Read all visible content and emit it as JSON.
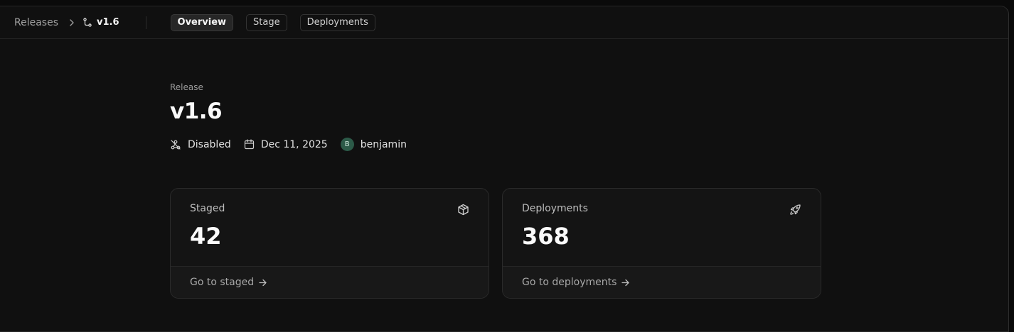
{
  "breadcrumb": {
    "parent": "Releases",
    "current": "v1.6"
  },
  "tabs": [
    {
      "label": "Overview",
      "active": true
    },
    {
      "label": "Stage",
      "active": false
    },
    {
      "label": "Deployments",
      "active": false
    }
  ],
  "release": {
    "eyebrow": "Release",
    "title": "v1.6",
    "status": "Disabled",
    "date": "Dec 11, 2025",
    "author_initial": "B",
    "author": "benjamin"
  },
  "cards": {
    "staged": {
      "label": "Staged",
      "value": "42",
      "link": "Go to staged"
    },
    "deployments": {
      "label": "Deployments",
      "value": "368",
      "link": "Go to deployments"
    }
  },
  "colors": {
    "background": "#101010",
    "card": "#141414",
    "avatar": "#2c5a48"
  },
  "icons": {
    "crumb_separator": "chevron-right-icon",
    "branch": "git-branch-icon",
    "status": "webhook-off-icon",
    "date": "calendar-icon",
    "staged": "package-icon",
    "deployments": "rocket-icon",
    "link": "arrow-right-icon"
  }
}
